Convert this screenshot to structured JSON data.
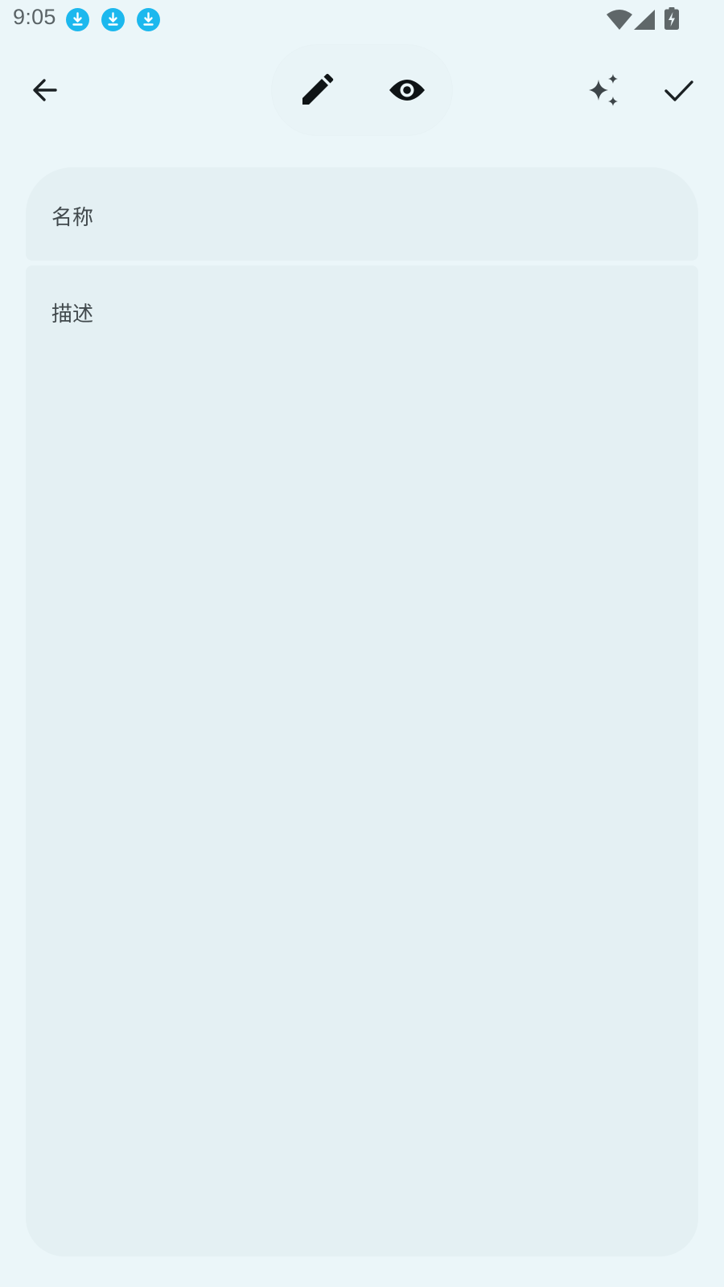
{
  "status_bar": {
    "time": "9:05",
    "notification_icons": [
      "download-icon",
      "download-icon",
      "download-icon"
    ],
    "system_icons": [
      "wifi-icon",
      "cellular-signal-icon",
      "battery-charging-icon"
    ],
    "accent_color": "#1cb8ee"
  },
  "toolbar": {
    "back_icon": "arrow-back-icon",
    "modes": [
      {
        "icon": "pencil-icon",
        "mode": "edit"
      },
      {
        "icon": "eye-icon",
        "mode": "preview"
      }
    ],
    "ai_icon": "sparkles-icon",
    "confirm_icon": "check-icon"
  },
  "form": {
    "name_placeholder": "名称",
    "description_placeholder": "描述"
  }
}
